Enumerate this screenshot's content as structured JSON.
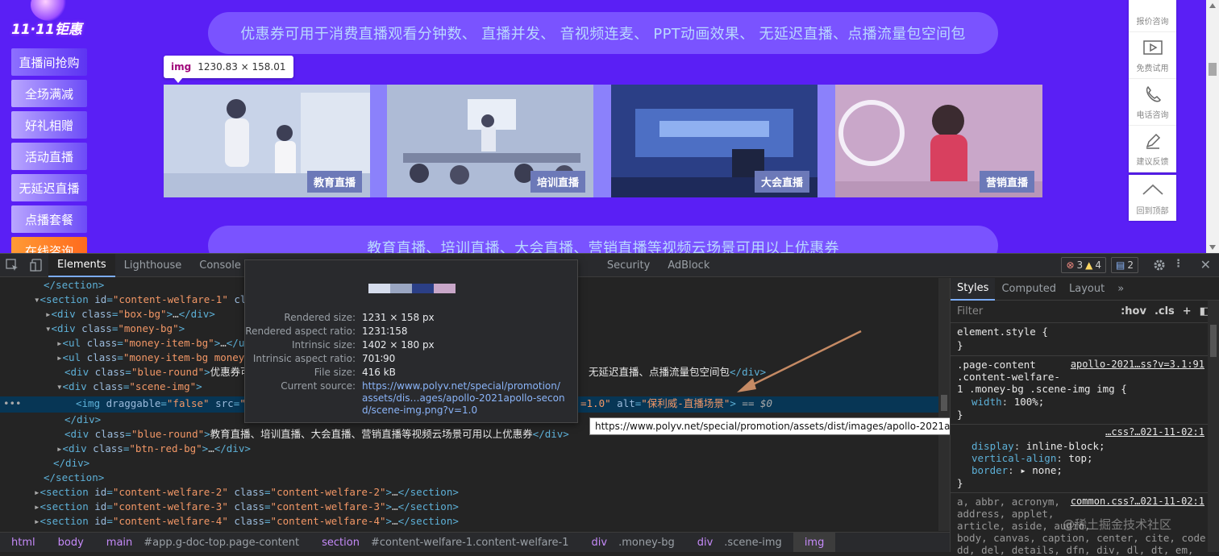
{
  "page": {
    "logo_text": "11·11钜惠",
    "nav": [
      "直播间抢购",
      "全场满减",
      "好礼相赠",
      "活动直播",
      "无延迟直播",
      "点播套餐",
      "在线咨询"
    ],
    "banner_top": "优惠券可用于消费直播观看分钟数、 直播并发、 音视频连麦、 PPT动画效果、 无延迟直播、点播流量包空间包",
    "banner_bottom": "教育直播、培训直播、大会直播、营销直播等视频云场景可用以上优惠券",
    "tooltip_tag": "img",
    "tooltip_size": "1230.83 × 158.01",
    "scenes": [
      "教育直播",
      "培训直播",
      "大会直播",
      "营销直播"
    ],
    "side_items": [
      "报价咨询",
      "免费试用",
      "电话咨询",
      "建议反馈"
    ],
    "back_top": "回到顶部"
  },
  "devtools": {
    "tabs": [
      "Elements",
      "Lighthouse",
      "Console",
      "Security",
      "AdBlock"
    ],
    "errors": "3",
    "warnings": "4",
    "messages": "2",
    "style_tabs": [
      "Styles",
      "Computed",
      "Layout"
    ],
    "filter_placeholder": "Filter",
    "filter_hov": ":hov",
    "filter_cls": ".cls",
    "breadcrumb": [
      {
        "tag": "html",
        "rest": ""
      },
      {
        "tag": "body",
        "rest": ""
      },
      {
        "tag": "main",
        "rest": "#app.g-doc-top.page-content"
      },
      {
        "tag": "section",
        "rest": "#content-welfare-1.content-welfare-1"
      },
      {
        "tag": "div",
        "rest": ".money-bg"
      },
      {
        "tag": "div",
        "rest": ".scene-img"
      },
      {
        "tag": "img",
        "rest": ""
      }
    ]
  },
  "popup": {
    "rendered_size_k": "Rendered size:",
    "rendered_size": "1231 × 158 px",
    "rendered_aspect_k": "Rendered aspect ratio:",
    "rendered_aspect": "1231∶158",
    "intrinsic_size_k": "Intrinsic size:",
    "intrinsic_size": "1402 × 180 px",
    "intrinsic_aspect_k": "Intrinsic aspect ratio:",
    "intrinsic_aspect": "701∶90",
    "file_size_k": "File size:",
    "file_size": "416 kB",
    "current_source_k": "Current source:",
    "current_source": "https://www.polyv.net/special/promotion/assets/dis…ages/apollo-2021apollo-second/scene-img.png?v=1.0"
  },
  "url_tooltip": "https://www.polyv.net/special/promotion/assets/dist/images/apollo-2021apollo-second/scene-img.png?v=1.0",
  "styles": {
    "element_style": "element.style {",
    "close_brace": "}",
    "rule1_sel_a": ".page-content",
    "rule1_sel_b": ".content-welfare-",
    "rule1_sel_c": "1 .money-bg .scene-img img {",
    "rule1_src": "apollo-2021…ss?v=3.1:91",
    "rule1_prop": "width",
    "rule1_val": "100%;",
    "rule2_src": "…css?…021-11-02:1",
    "rule2_prop1": "display",
    "rule2_val1": "inline-block;",
    "rule2_prop2": "vertical-align",
    "rule2_val2": "top;",
    "rule2_prop3": "border",
    "rule2_val3": "▸ none;",
    "rule3_sel1": "a, abbr, acronym,",
    "rule3_sel2": "address, applet,",
    "rule3_sel3": "article, aside, audio,",
    "rule3_sel4": "body, canvas, caption, center, cite, code,",
    "rule3_sel5": "dd, del, details, dfn, div, dl, dt, em,",
    "rule3_src": "common.css?…021-11-02:1"
  },
  "watermark": "@稀土掘金技术社区",
  "colors": {
    "page_bg": "#5a1ff5",
    "selection": "#073655",
    "arrow": "#c58a64"
  }
}
